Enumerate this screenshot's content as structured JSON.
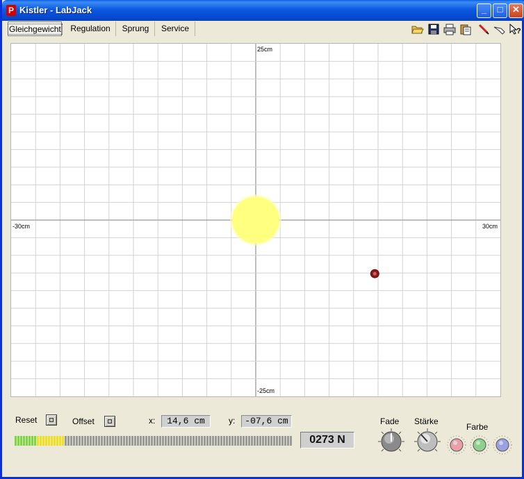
{
  "window": {
    "title": "Kistler - LabJack",
    "app_icon_glyph": "P",
    "minimize_glyph": "_",
    "maximize_glyph": "□",
    "close_glyph": "✕"
  },
  "tabs": [
    {
      "label": "Gleichgewicht",
      "active": true
    },
    {
      "label": "Regulation",
      "active": false
    },
    {
      "label": "Sprung",
      "active": false
    },
    {
      "label": "Service",
      "active": false
    }
  ],
  "toolbar_icons": [
    "open-folder-icon",
    "save-icon",
    "print-icon",
    "clipboard-icon",
    "pencil-icon",
    "pointer-icon",
    "help-icon"
  ],
  "plot": {
    "top_label": "25cm",
    "bottom_label": "-25cm",
    "left_label": "-30cm",
    "right_label": "30cm",
    "x_range": [
      -30,
      30
    ],
    "y_range": [
      -25,
      25
    ],
    "target": {
      "x": 0,
      "y": 0,
      "color": "#ffff80"
    },
    "marker": {
      "x": 14.6,
      "y": -7.6,
      "color": "#8b1a1a"
    }
  },
  "controls": {
    "reset_label": "Reset",
    "offset_label": "Offset",
    "x_label": "x:",
    "x_value": "14,6  cm",
    "y_label": "y:",
    "y_value": "-07,6  cm",
    "force_value": "0273  N",
    "meter_level_percent": 18,
    "fade_label": "Fade",
    "staerke_label": "Stärke",
    "farbe_label": "Farbe",
    "color_options": [
      "#e8a0a8",
      "#8fd08f",
      "#9aa0e0"
    ]
  }
}
